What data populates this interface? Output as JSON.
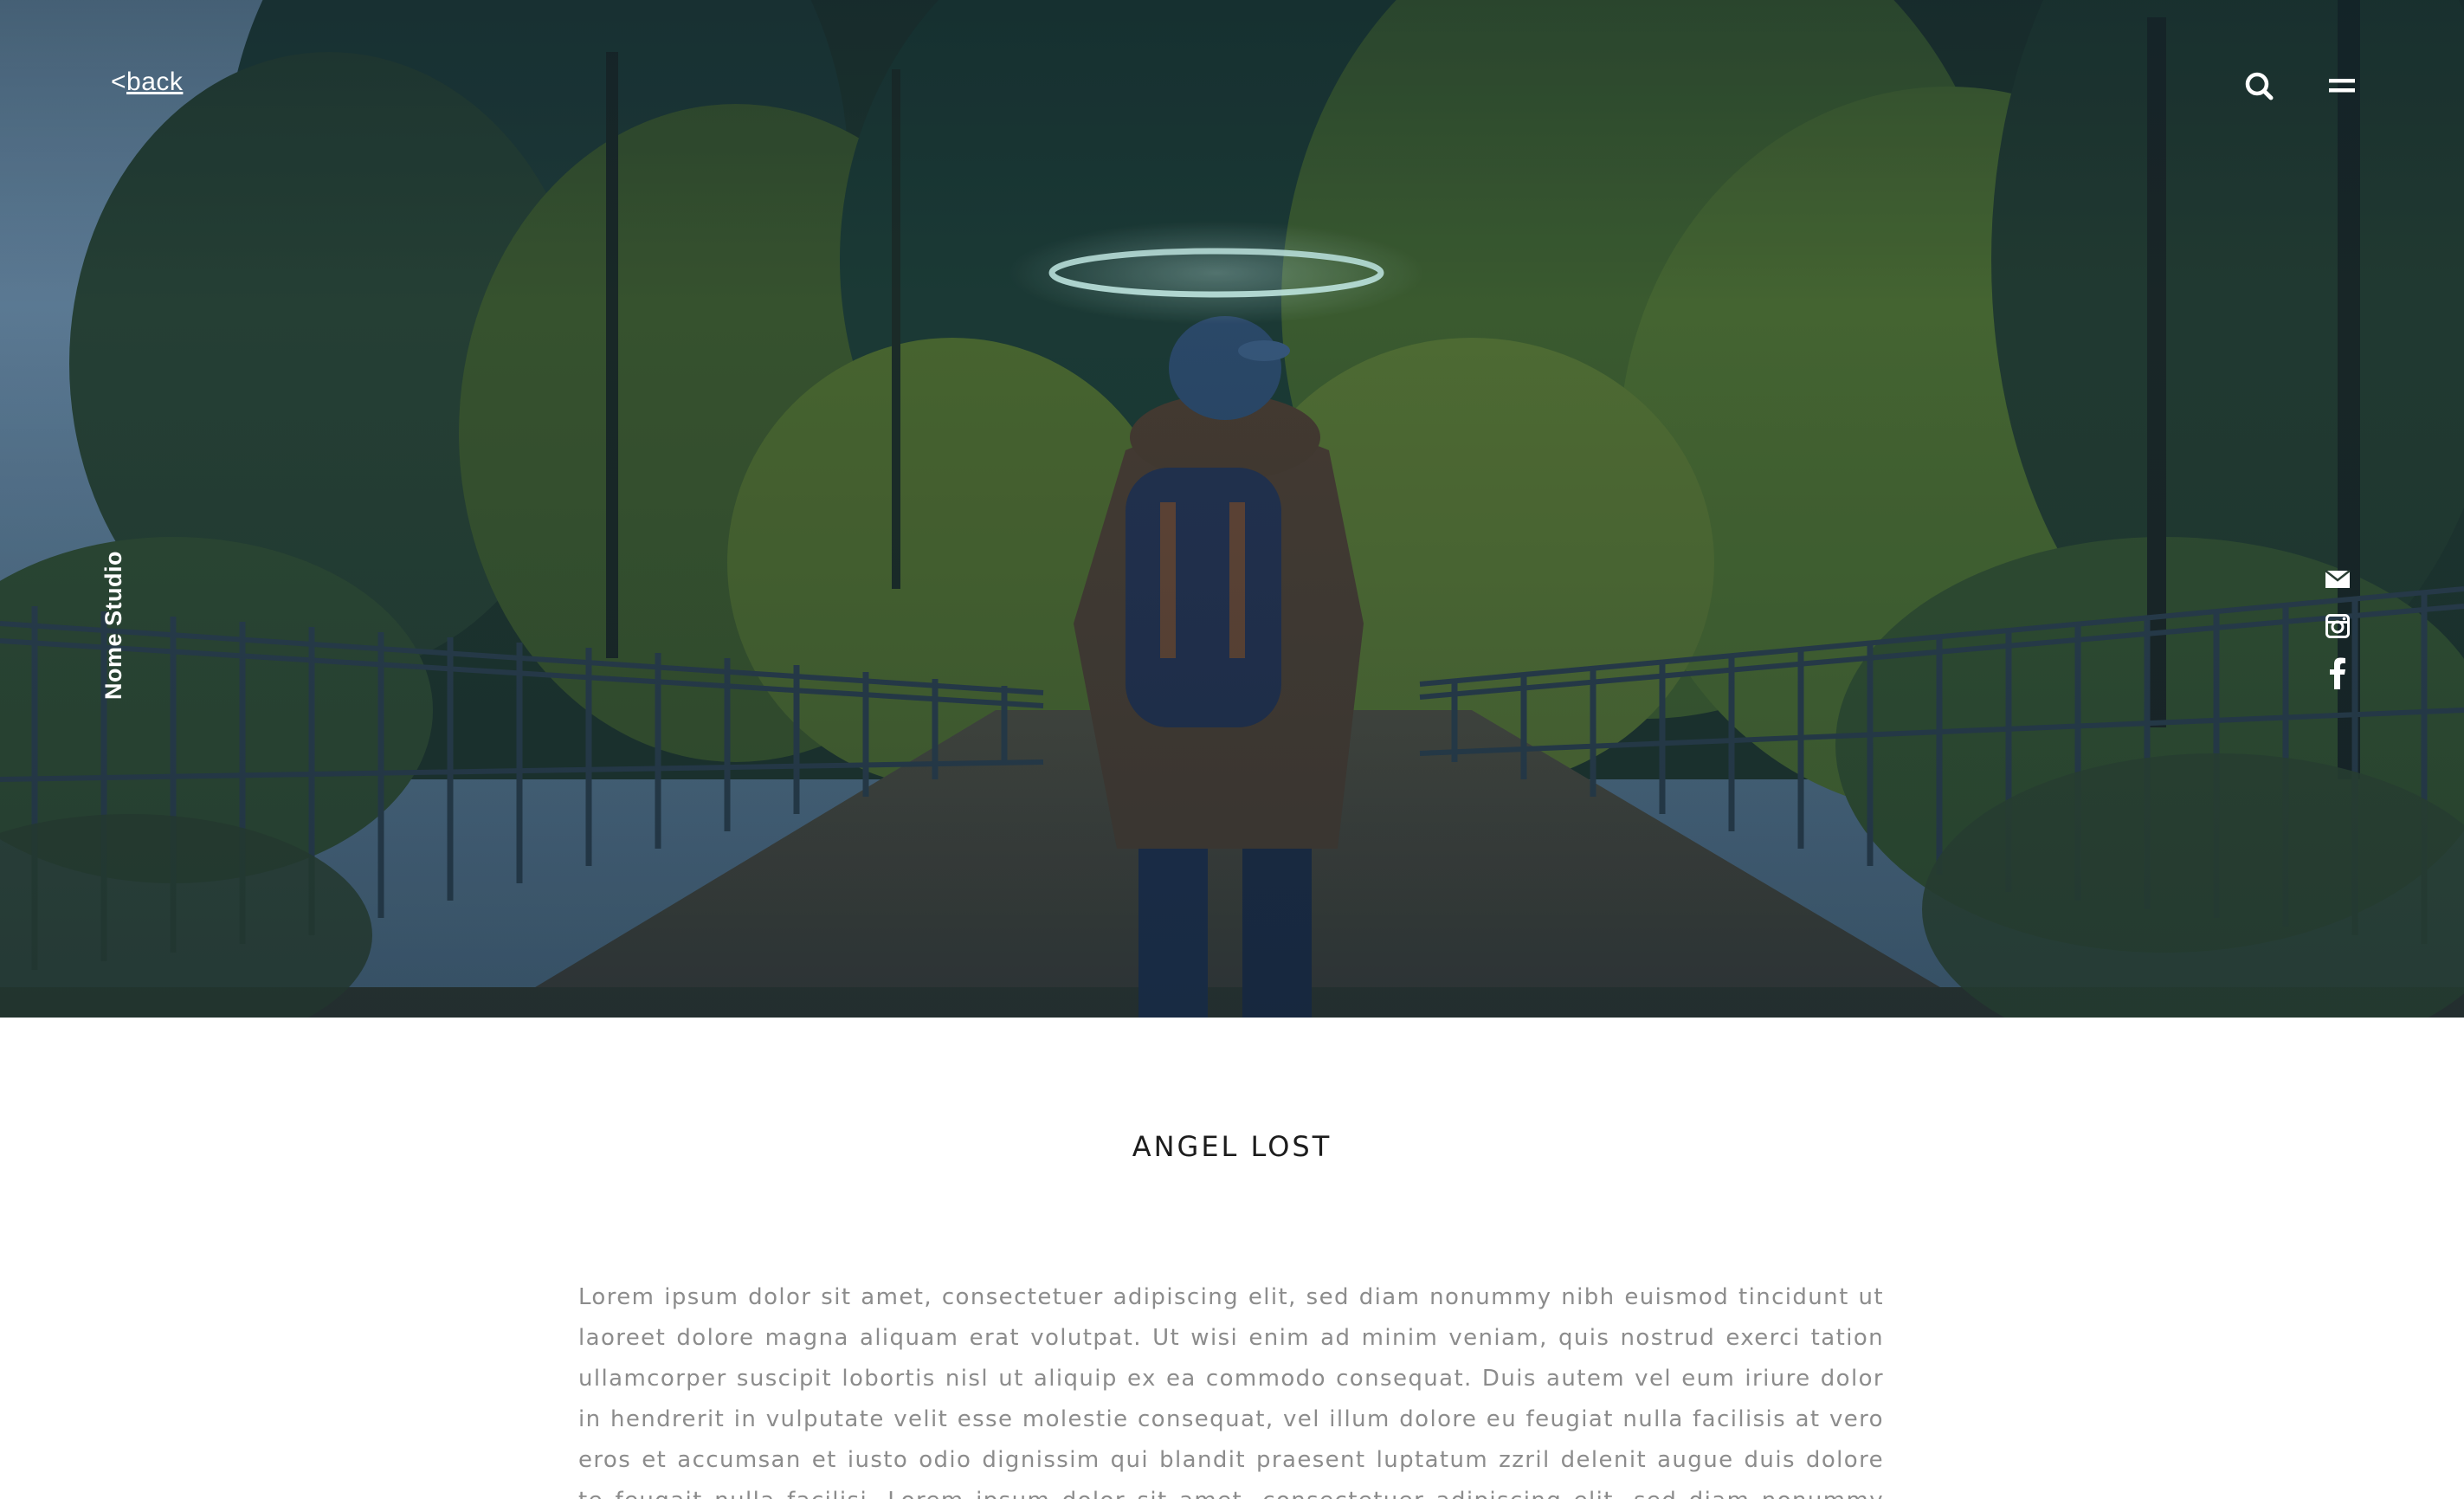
{
  "nav": {
    "back_prefix": "<",
    "back_label": "back"
  },
  "header_icons": {
    "search": "search-icon",
    "menu": "menu-icon"
  },
  "brand": {
    "name": "Nome Studio"
  },
  "social": [
    {
      "name": "mail-icon"
    },
    {
      "name": "instagram-icon"
    },
    {
      "name": "facebook-icon"
    }
  ],
  "article": {
    "title": "ANGEL LOST",
    "body": "Lorem ipsum dolor sit amet, consectetuer adipiscing elit, sed diam nonummy nibh euismod tincidunt ut laoreet dolore magna aliquam erat volutpat. Ut wisi enim ad minim veniam, quis nostrud exerci tation ullamcorper suscipit lobortis nisl ut aliquip ex ea commodo consequat. Duis autem vel eum iriure dolor in hendrerit in vulputate velit esse molestie consequat, vel illum dolore eu feugiat nulla facilisis at vero eros et accumsan et iusto odio dignissim qui blandit praesent luptatum zzril delenit augue duis dolore te feugait nulla facilisi. Lorem ipsum dolor sit amet, consectetuer adipiscing elit, sed diam nonummy nibh euismod tincidunt ut laoreet dolore magna aliquam erat volutpat."
  },
  "colors": {
    "hero_sky": "#5d7c94",
    "hero_foliage": "#3f5a2a",
    "halo": "#d7fff4",
    "body_text": "#8c8c8c",
    "title_text": "#1c1c1c"
  }
}
